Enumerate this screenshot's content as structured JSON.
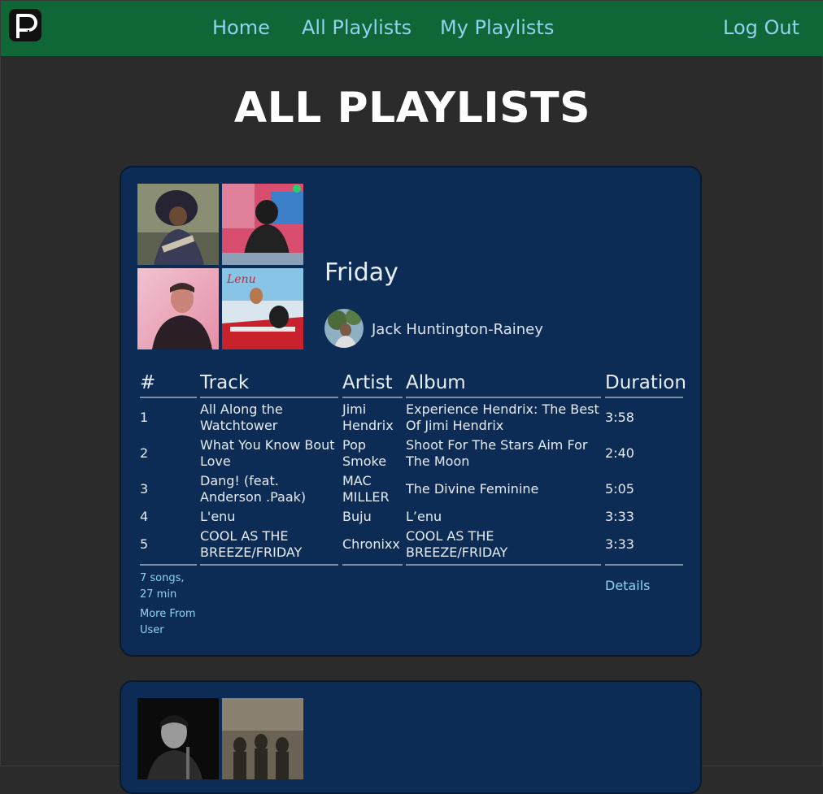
{
  "nav": {
    "links": [
      "Home",
      "All Playlists",
      "My Playlists"
    ],
    "logout": "Log Out",
    "logo_icon": "playlist-logo-icon"
  },
  "page": {
    "title": "ALL PLAYLISTS"
  },
  "playlists": [
    {
      "name": "Friday",
      "owner": "Jack Huntington-Rainey",
      "columns": [
        "#",
        "Track",
        "Artist",
        "Album",
        "Duration"
      ],
      "tracks": [
        {
          "num": "1",
          "track": "All Along the Watchtower",
          "artist": "Jimi Hendrix",
          "album": "Experience Hendrix: The Best Of Jimi Hendrix",
          "duration": "3:58"
        },
        {
          "num": "2",
          "track": "What You Know Bout Love",
          "artist": "Pop Smoke",
          "album": "Shoot For The Stars Aim For The Moon",
          "duration": "2:40"
        },
        {
          "num": "3",
          "track": "Dang! (feat. Anderson .Paak)",
          "artist": "MAC MILLER",
          "album": "The Divine Feminine",
          "duration": "5:05"
        },
        {
          "num": "4",
          "track": "L'enu",
          "artist": "Buju",
          "album": "L’enu",
          "duration": "3:33"
        },
        {
          "num": "5",
          "track": "COOL AS THE BREEZE/FRIDAY",
          "artist": "Chronixx",
          "album": "COOL AS THE BREEZE/FRIDAY",
          "duration": "3:33"
        }
      ],
      "stats": "7 songs, 27 min",
      "more_link": "More From User",
      "details_link": "Details"
    }
  ],
  "colors": {
    "navbar": "#0f6637",
    "link": "#8fd3ee",
    "background": "#2b2b2b",
    "card": "#0d2c55"
  }
}
